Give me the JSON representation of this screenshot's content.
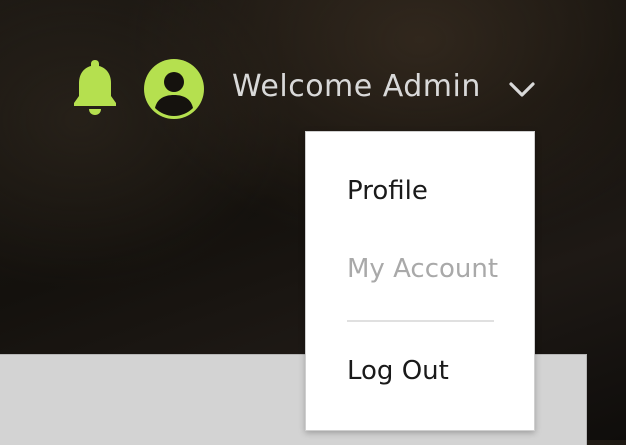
{
  "header": {
    "welcome_text": "Welcome Admin",
    "icons": {
      "notification": "bell-icon",
      "user": "user-avatar-icon",
      "dropdown": "chevron-down-icon"
    }
  },
  "user_menu": {
    "items": [
      {
        "label": "Profile",
        "state": "normal"
      },
      {
        "label": "My Account",
        "state": "muted"
      },
      {
        "label": "Log Out",
        "state": "normal"
      }
    ]
  },
  "colors": {
    "accent": "#b5e04f",
    "header_text": "#d9d9d9",
    "menu_text": "#1a1a1a",
    "menu_text_muted": "#a9a9a9",
    "menu_background": "#ffffff",
    "page_panel": "#d3d3d3"
  }
}
